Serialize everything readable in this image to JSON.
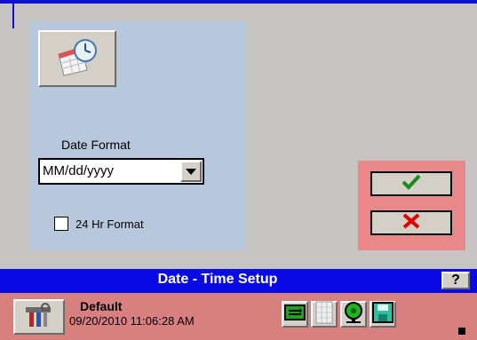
{
  "date_panel": {
    "date_format_label": "Date Format",
    "date_format_value": "MM/dd/yyyy",
    "hr24_label": "24 Hr Format",
    "hr24_checked": false
  },
  "header": {
    "title": "Date - Time Setup",
    "help_label": "?"
  },
  "status": {
    "profile": "Default",
    "timestamp": "09/20/2010 11:06:28 AM"
  },
  "icons": {
    "calendar": "calendar-clock-icon",
    "ok": "checkmark-icon",
    "cancel": "x-icon",
    "tools": "tools-icon",
    "status": [
      "network-icon",
      "list-icon",
      "alarm-bell-icon",
      "save-icon"
    ]
  },
  "colors": {
    "title_bar": "#0a0ae6",
    "status_bar": "#d88080",
    "action_panel": "#e88888",
    "date_panel": "#b8c8dc",
    "ok_check": "#1a8a1a",
    "cancel_x": "#e00000"
  }
}
